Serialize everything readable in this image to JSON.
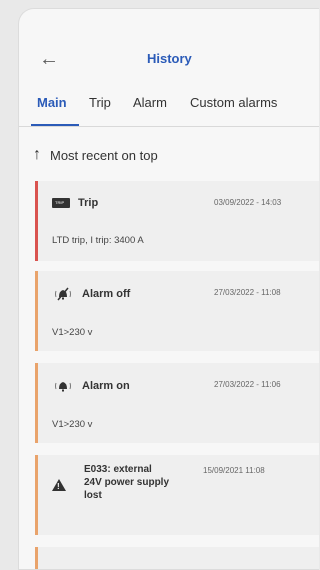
{
  "header": {
    "title": "History",
    "back_icon": "back-arrow-icon"
  },
  "tabs": [
    {
      "label": "Main",
      "active": true
    },
    {
      "label": "Trip",
      "active": false
    },
    {
      "label": "Alarm",
      "active": false
    },
    {
      "label": "Custom alarms",
      "active": false
    }
  ],
  "sort": {
    "label": "Most recent on top",
    "icon": "arrow-up-icon"
  },
  "events": [
    {
      "type": "trip",
      "name": "Trip",
      "date": "03/09/2022 - 14:03",
      "detail": "LTD trip, I trip: 3400 A",
      "accent": "#d9534f"
    },
    {
      "type": "alarm-off",
      "name": "Alarm off",
      "date": "27/03/2022 - 11:08",
      "detail": "V1>230 v",
      "accent": "#e9a36b"
    },
    {
      "type": "alarm-on",
      "name": "Alarm on",
      "date": "27/03/2022 - 11:06",
      "detail": "V1>230 v",
      "accent": "#e9a36b"
    },
    {
      "type": "warning",
      "name_line1": "E033: external",
      "name_line2": "24V power supply",
      "name_line3": "lost",
      "date": "15/09/2021  11:08",
      "accent": "#e9a36b"
    }
  ],
  "colors": {
    "accent_blue": "#2b5bb8",
    "trip_red": "#d9534f",
    "alarm_orange": "#e9a36b"
  }
}
